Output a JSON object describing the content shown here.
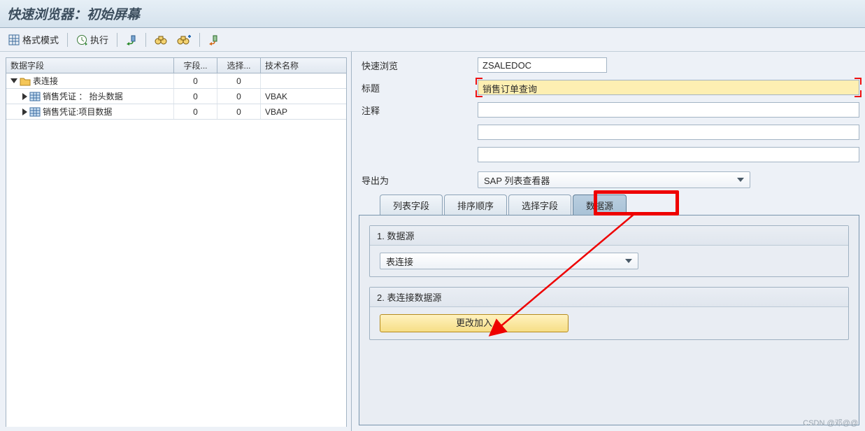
{
  "title": "快速浏览器：初始屏幕",
  "toolbar": {
    "format_mode": "格式模式",
    "execute": "执行"
  },
  "left": {
    "headers": {
      "c1": "数据字段",
      "c2": "字段...",
      "c3": "选择...",
      "c4": "技术名称"
    },
    "rows": [
      {
        "level": 0,
        "open": true,
        "icon": "folder",
        "label": "表连接",
        "f": "0",
        "s": "0",
        "tech": ""
      },
      {
        "level": 1,
        "open": false,
        "icon": "table",
        "label": "销售凭证 ： 抬头数据",
        "f": "0",
        "s": "0",
        "tech": "VBAK"
      },
      {
        "level": 1,
        "open": false,
        "icon": "table",
        "label": "销售凭证:项目数据",
        "f": "0",
        "s": "0",
        "tech": "VBAP"
      }
    ]
  },
  "right": {
    "quickview_label": "快速浏览",
    "quickview_value": "ZSALEDOC",
    "title_label": "标题",
    "title_value": "销售订单查询",
    "notes_label": "注释",
    "export_label": "导出为",
    "export_value": "SAP 列表查看器",
    "tabs": [
      "列表字段",
      "排序顺序",
      "选择字段",
      "数据源"
    ],
    "active_tab": 3,
    "group1_title": "1. 数据源",
    "group1_value": "表连接",
    "group2_title": "2. 表连接数据源",
    "group2_button": "更改加入"
  },
  "watermark": "CSDN @邓@@"
}
